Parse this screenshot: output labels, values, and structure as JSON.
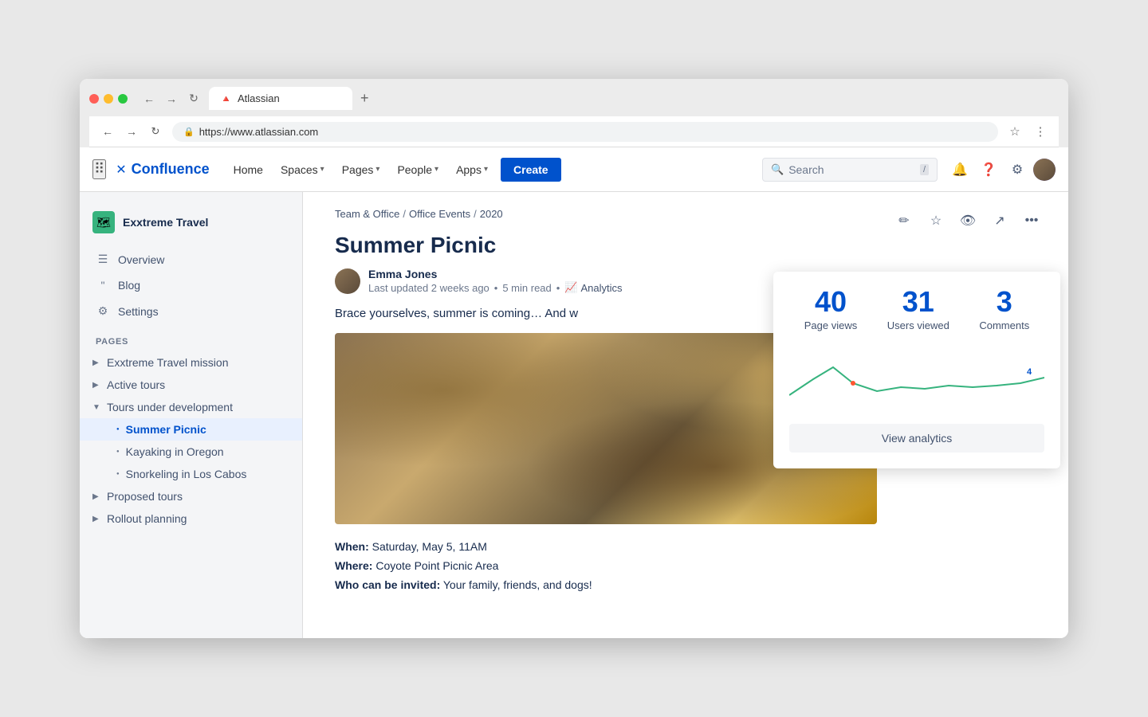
{
  "browser": {
    "tab_title": "Atlassian",
    "url": "https://www.atlassian.com",
    "tab_plus": "+",
    "favicon": "🔺"
  },
  "nav": {
    "grid_icon": "⋮⋮",
    "logo_text": "Confluence",
    "home": "Home",
    "spaces": "Spaces",
    "pages": "Pages",
    "people": "People",
    "apps": "Apps",
    "create": "Create",
    "search_placeholder": "Search",
    "search_slash": "/"
  },
  "sidebar": {
    "space_name": "Exxtreme Travel",
    "space_icon": "🗺",
    "overview": "Overview",
    "blog": "Blog",
    "settings": "Settings",
    "pages_label": "PAGES",
    "pages": [
      {
        "label": "Exxtreme Travel mission",
        "level": 0,
        "expanded": false
      },
      {
        "label": "Active tours",
        "level": 0,
        "expanded": false
      },
      {
        "label": "Tours under development",
        "level": 0,
        "expanded": true
      },
      {
        "label": "Summer Picnic",
        "level": 1,
        "active": true
      },
      {
        "label": "Kayaking in Oregon",
        "level": 1,
        "active": false
      },
      {
        "label": "Snorkeling in Los Cabos",
        "level": 1,
        "active": false
      },
      {
        "label": "Proposed tours",
        "level": 0,
        "expanded": false
      },
      {
        "label": "Rollout planning",
        "level": 0,
        "expanded": false
      }
    ]
  },
  "content": {
    "breadcrumb": [
      "Team & Office",
      "Office Events",
      "2020"
    ],
    "page_title": "Summer Picnic",
    "author_name": "Emma Jones",
    "last_updated": "Last updated 2 weeks ago",
    "read_time": "5 min read",
    "analytics_link": "Analytics",
    "intro_text": "Brace yourselves, summer is coming… And w",
    "when_label": "When:",
    "when_value": "Saturday, May 5, 11AM",
    "where_label": "Where:",
    "where_value": "Coyote Point Picnic Area",
    "who_label": "Who can be invited:",
    "who_value": "Your family, friends, and dogs!"
  },
  "analytics_popup": {
    "page_views_number": "40",
    "page_views_label": "Page views",
    "users_viewed_number": "31",
    "users_viewed_label": "Users viewed",
    "comments_number": "3",
    "comments_label": "Comments",
    "chart_end_value": "4",
    "view_analytics_btn": "View analytics"
  }
}
